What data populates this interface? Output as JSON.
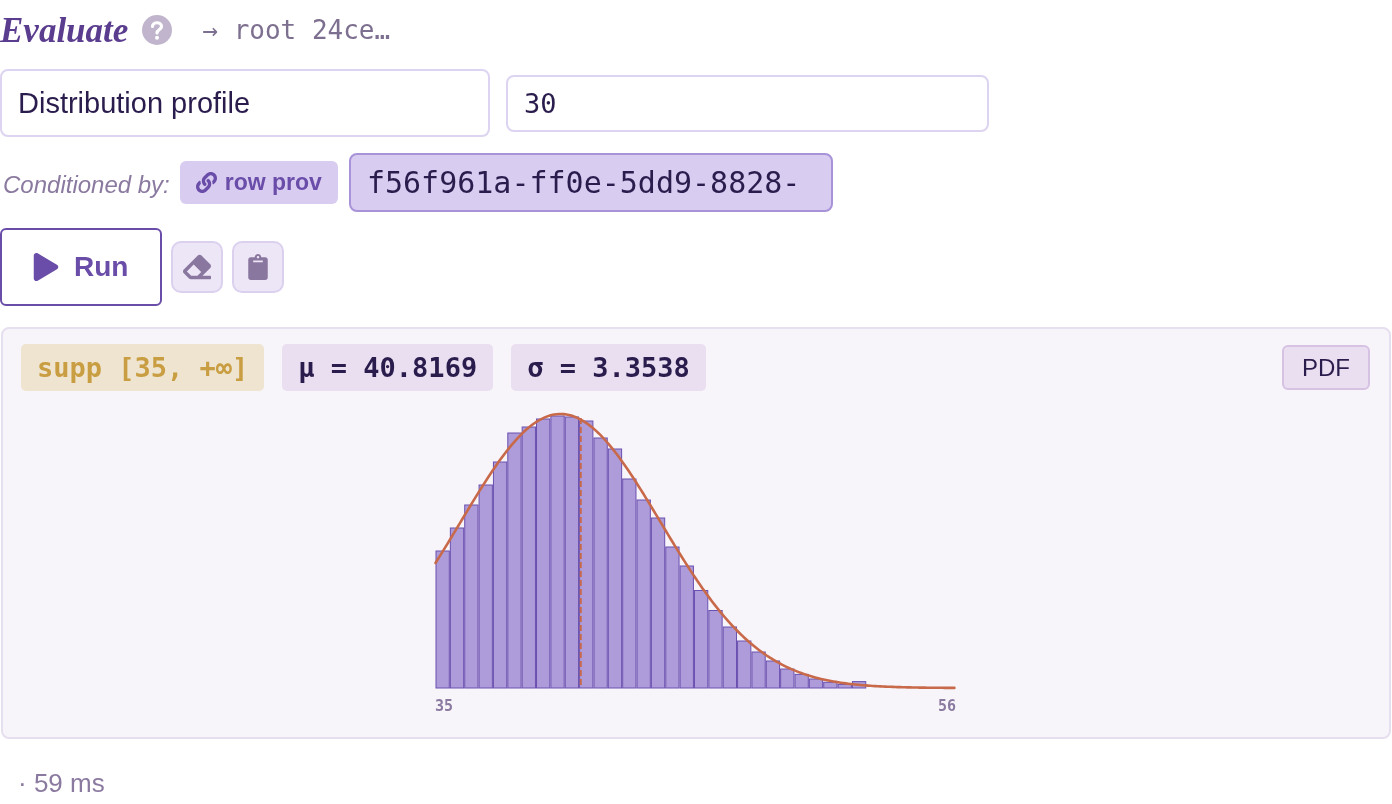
{
  "header": {
    "title": "Evaluate",
    "path": "→ root 24ce…"
  },
  "inputs": {
    "label": {
      "value": "Distribution profile"
    },
    "count": {
      "value": "30"
    }
  },
  "condition": {
    "label": "Conditioned by:",
    "chip": "row prov",
    "row_id": "f56f961a-ff0e-5dd9-8828-"
  },
  "actions": {
    "run": "Run"
  },
  "result": {
    "stats": [
      {
        "kind": "support",
        "text": "supp [35, +∞]"
      },
      {
        "kind": "stat",
        "text": "μ = 40.8169"
      },
      {
        "kind": "stat",
        "text": "σ = 3.3538"
      }
    ],
    "mode_button": "PDF",
    "axis": {
      "min": "35",
      "max": "56"
    }
  },
  "footer": {
    "timing": "· 59 ms"
  }
}
